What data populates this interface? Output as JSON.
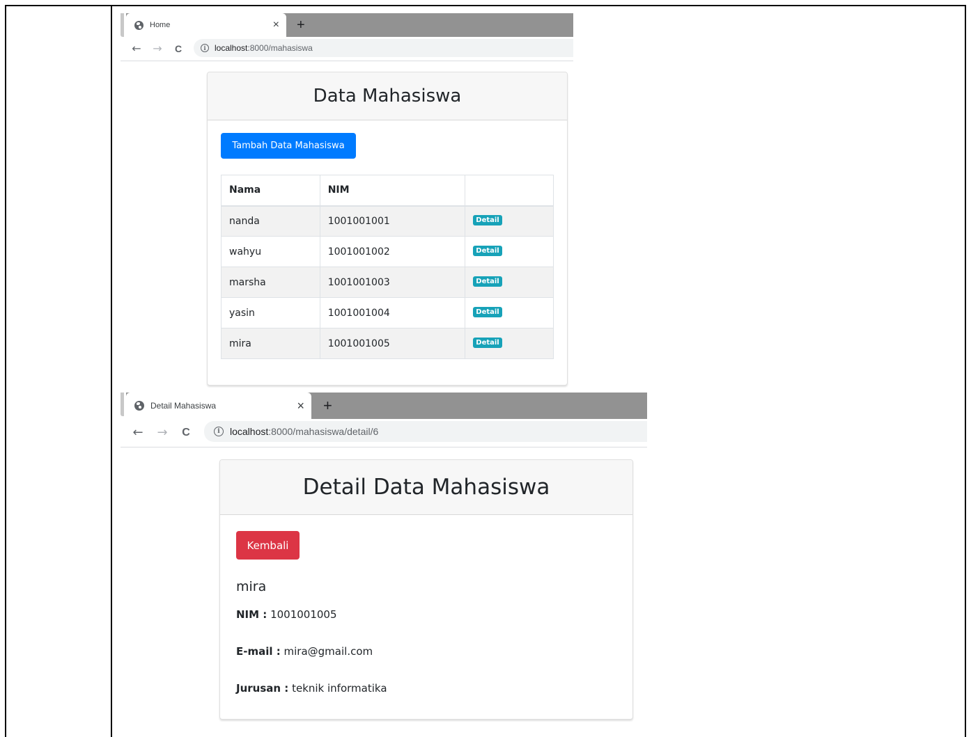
{
  "screen1": {
    "tab": {
      "title": "Home",
      "close": "×",
      "new_tab": "+"
    },
    "nav": {
      "back": "←",
      "forward": "→",
      "reload": "C"
    },
    "url": {
      "info": "i",
      "host": "localhost",
      "path": ":8000/mahasiswa"
    },
    "card_title": "Data Mahasiswa",
    "add_button": "Tambah Data Mahasiswa",
    "table": {
      "headers": [
        "Nama",
        "NIM",
        ""
      ],
      "rows": [
        {
          "nama": "nanda",
          "nim": "1001001001",
          "action": "Detail"
        },
        {
          "nama": "wahyu",
          "nim": "1001001002",
          "action": "Detail"
        },
        {
          "nama": "marsha",
          "nim": "1001001003",
          "action": "Detail"
        },
        {
          "nama": "yasin",
          "nim": "1001001004",
          "action": "Detail"
        },
        {
          "nama": "mira",
          "nim": "1001001005",
          "action": "Detail"
        }
      ]
    }
  },
  "screen2": {
    "tab": {
      "title": "Detail Mahasiswa",
      "close": "×",
      "new_tab": "+"
    },
    "nav": {
      "back": "←",
      "forward": "→",
      "reload": "C"
    },
    "url": {
      "info": "i",
      "host": "localhost",
      "path": ":8000/mahasiswa/detail/6"
    },
    "card_title": "Detail Data Mahasiswa",
    "back_button": "Kembali",
    "student": {
      "name": "mira",
      "nim_label": "NIM :",
      "nim": "1001001005",
      "email_label": "E-mail :",
      "email": "mira@gmail.com",
      "jurusan_label": "Jurusan :",
      "jurusan": "teknik informatika"
    }
  },
  "colors": {
    "primary": "#007bff",
    "danger": "#dc3545",
    "info": "#17a2b8",
    "tabstrip": "#929292"
  }
}
